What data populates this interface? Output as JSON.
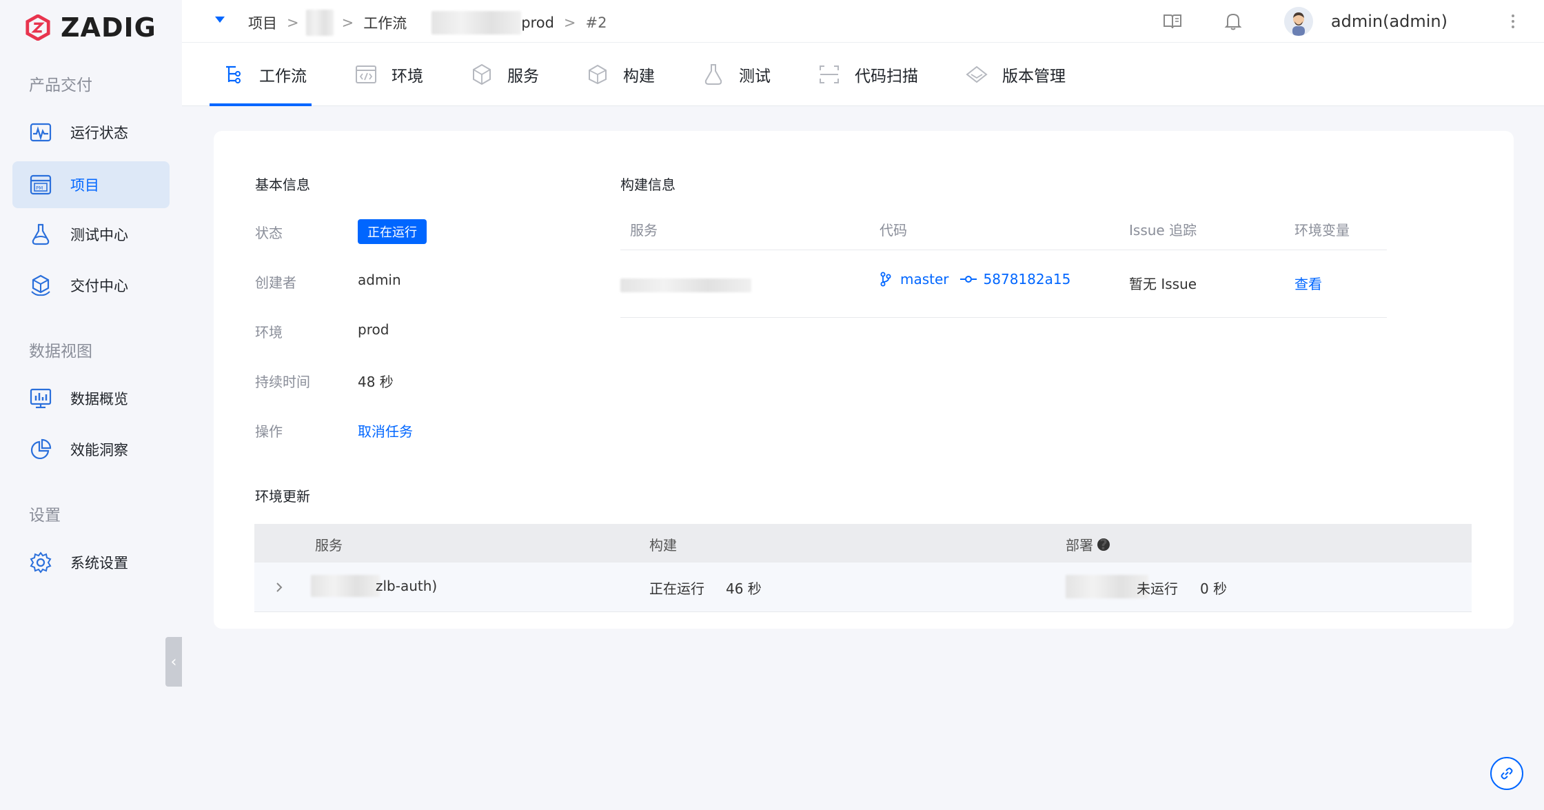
{
  "brand": {
    "name": "ZADIG",
    "accent": "#0066ff",
    "logo_color": "#e8344e"
  },
  "sidebar": {
    "sections": [
      {
        "label": "产品交付"
      },
      {
        "label": "数据视图"
      },
      {
        "label": "设置"
      }
    ],
    "items": [
      {
        "label": "运行状态",
        "icon": "pulse-monitor-icon"
      },
      {
        "label": "项目",
        "icon": "project-board-icon",
        "active": true
      },
      {
        "label": "测试中心",
        "icon": "flask-icon"
      },
      {
        "label": "交付中心",
        "icon": "package-hand-icon"
      },
      {
        "label": "数据概览",
        "icon": "bar-monitor-icon"
      },
      {
        "label": "效能洞察",
        "icon": "pie-chart-icon"
      },
      {
        "label": "系统设置",
        "icon": "gear-icon"
      }
    ],
    "collapse_glyph": "‹"
  },
  "topbar": {
    "breadcrumb": {
      "project_label": "项目",
      "workflow_label": "工作流",
      "env_suffix": "prod",
      "task_number": "#2",
      "separator": ">"
    },
    "username": "admin(admin)"
  },
  "tabs": [
    {
      "label": "工作流",
      "icon": "workflow-icon",
      "active": true
    },
    {
      "label": "环境",
      "icon": "code-env-icon"
    },
    {
      "label": "服务",
      "icon": "cubes-icon"
    },
    {
      "label": "构建",
      "icon": "cube-icon"
    },
    {
      "label": "测试",
      "icon": "flask-icon"
    },
    {
      "label": "代码扫描",
      "icon": "scan-icon"
    },
    {
      "label": "版本管理",
      "icon": "diamond-icon"
    }
  ],
  "basic_info": {
    "title": "基本信息",
    "status_label": "状态",
    "status_value": "正在运行",
    "creator_label": "创建者",
    "creator_value": "admin",
    "env_label": "环境",
    "env_value": "prod",
    "duration_label": "持续时间",
    "duration_value": "48 秒",
    "action_label": "操作",
    "action_value": "取消任务"
  },
  "build_info": {
    "title": "构建信息",
    "headers": {
      "service": "服务",
      "code": "代码",
      "issue": "Issue 追踪",
      "env_vars": "环境变量"
    },
    "row": {
      "branch": "master",
      "commit": "5878182a15",
      "issue": "暂无 Issue",
      "env_vars_link": "查看"
    }
  },
  "env_update": {
    "title": "环境更新",
    "headers": {
      "service": "服务",
      "build": "构建",
      "deploy": "部署"
    },
    "row": {
      "service_suffix": "zlb-auth)",
      "build_status": "正在运行",
      "build_duration": "46 秒",
      "deploy_status": "未运行",
      "deploy_duration": "0 秒"
    },
    "help_glyph": "?"
  }
}
